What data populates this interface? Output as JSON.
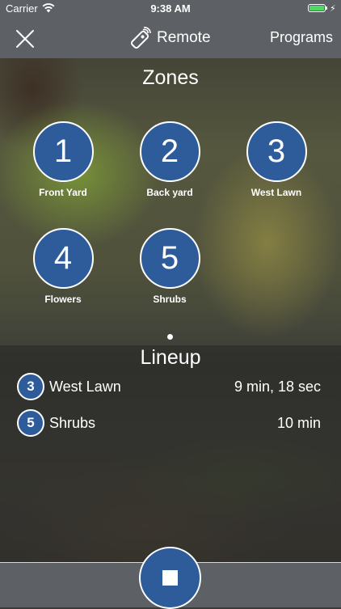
{
  "status_bar": {
    "carrier": "Carrier",
    "time": "9:38 AM",
    "battery_color": "#4cd964"
  },
  "nav": {
    "title": "Remote",
    "right_button": "Programs",
    "left_icon": "close-icon",
    "title_icon": "remote-icon"
  },
  "zones": {
    "title": "Zones",
    "items": [
      {
        "number": "1",
        "label": "Front Yard"
      },
      {
        "number": "2",
        "label": "Back yard"
      },
      {
        "number": "3",
        "label": "West Lawn"
      },
      {
        "number": "4",
        "label": "Flowers"
      },
      {
        "number": "5",
        "label": "Shrubs"
      }
    ]
  },
  "lineup": {
    "title": "Lineup",
    "rows": [
      {
        "number": "3",
        "name": "West Lawn",
        "duration": "9 min, 18 sec"
      },
      {
        "number": "5",
        "name": "Shrubs",
        "duration": "10 min"
      }
    ]
  },
  "bottom": {
    "stop_icon": "stop-icon"
  },
  "colors": {
    "accent": "#2e5c9b",
    "bar": "#5d6166"
  }
}
